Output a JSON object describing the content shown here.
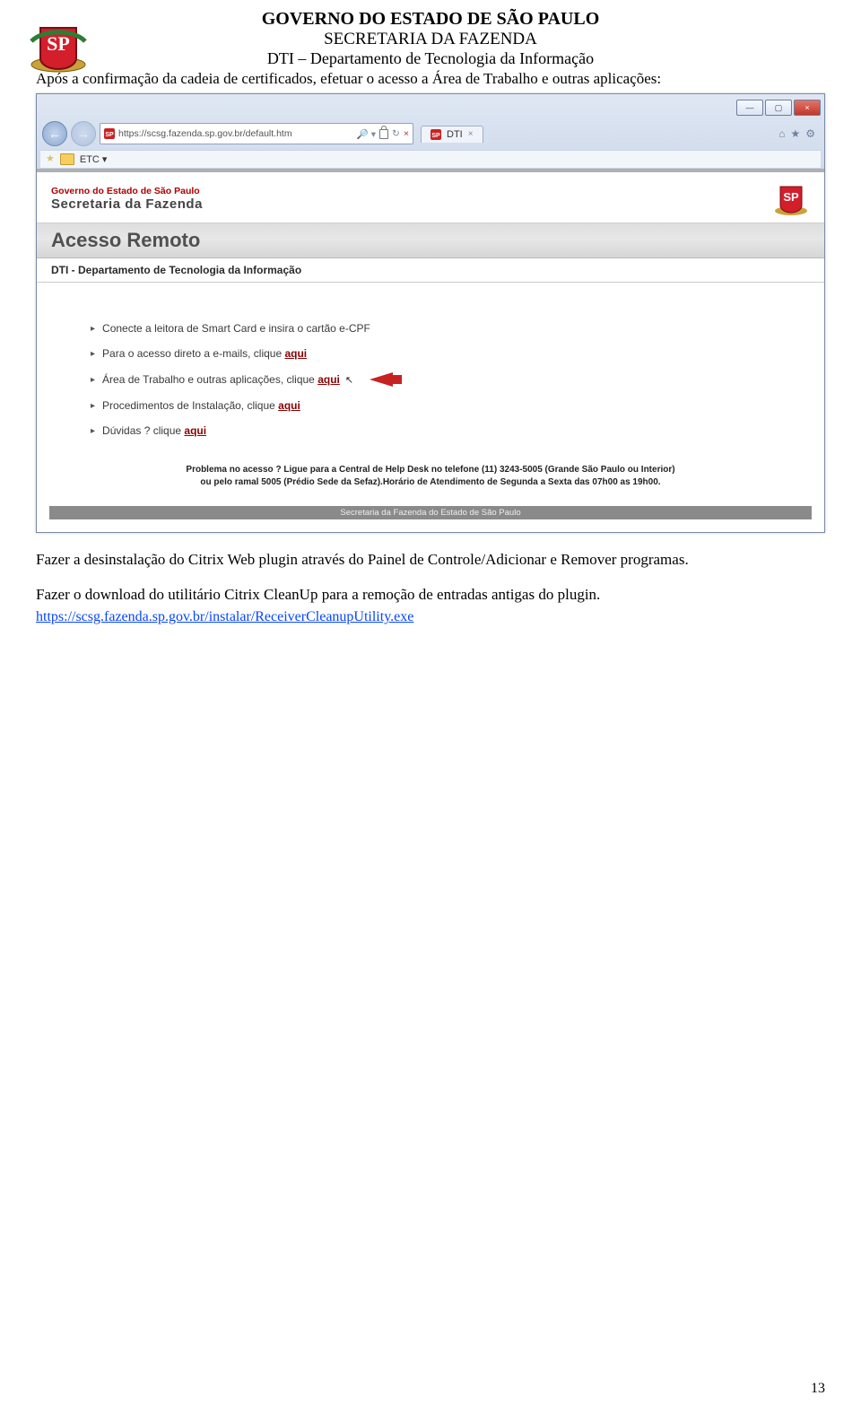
{
  "doc_header": {
    "line1": "GOVERNO DO ESTADO DE SÃO PAULO",
    "line2": "SECRETARIA DA FAZENDA",
    "line3": "DTI – Departamento de Tecnologia da Informação"
  },
  "intro_text": "Após a confirmação da cadeia de certificados, efetuar o acesso a Área de Trabalho e outras aplicações:",
  "browser": {
    "url": "https://scsg.fazenda.sp.gov.br/default.htm",
    "search_hint": "🔎 ▾",
    "refresh_hint": "↻",
    "tab_title": "DTI",
    "tab_close": "×",
    "fav_label": "ETC ▾",
    "win_min": "—",
    "win_max": "▢",
    "win_close": "×",
    "nav_back": "←",
    "nav_fwd": "→",
    "icon_home": "⌂",
    "icon_star": "★",
    "icon_gear": "⚙",
    "cert_x": "×"
  },
  "portal": {
    "gov_line": "Governo do Estado de São Paulo",
    "sec_line": "Secretaria da Fazenda",
    "banner": "Acesso Remoto",
    "sub_banner": "DTI - Departamento de Tecnologia da Informação",
    "items": [
      {
        "text": "Conecte a leitora de Smart Card e insira o cartão e-CPF",
        "link": ""
      },
      {
        "text": "Para o acesso direto a e-mails, clique ",
        "link": "aqui"
      },
      {
        "text": "Área de Trabalho e outras aplicações, clique ",
        "link": "aqui"
      },
      {
        "text": "Procedimentos de Instalação, clique ",
        "link": "aqui"
      },
      {
        "text": "Dúvidas ? clique ",
        "link": "aqui"
      }
    ],
    "help_line1": "Problema no acesso ? Ligue para a Central de Help Desk no telefone (11) 3243-5005 (Grande São Paulo ou Interior)",
    "help_line2": "ou pelo ramal 5005 (Prédio Sede da Sefaz).Horário de Atendimento de Segunda a Sexta das 07h00 as 19h00.",
    "footer": "Secretaria da Fazenda do Estado de São Paulo"
  },
  "para2": "Fazer a desinstalação do Citrix Web plugin através do Painel de Controle/Adicionar e Remover programas.",
  "para3": "Fazer o download do utilitário Citrix CleanUp para a remoção de entradas antigas do plugin.",
  "link_url": "https://scsg.fazenda.sp.gov.br/instalar/ReceiverCleanupUtility.exe",
  "page_number": "13"
}
